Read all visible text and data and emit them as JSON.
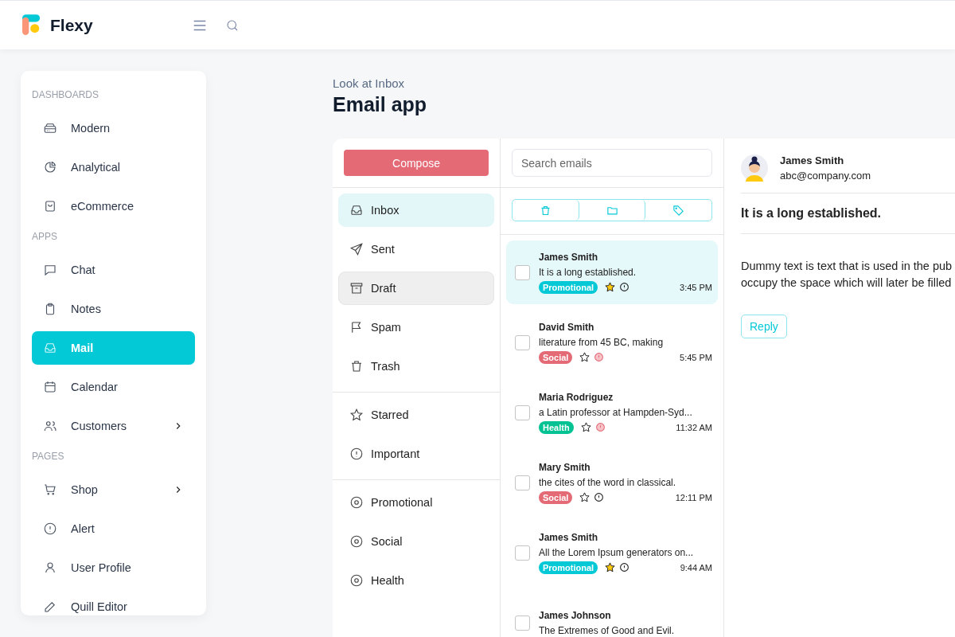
{
  "brand": "Flexy",
  "sidebar": {
    "sections": [
      {
        "title": "DASHBOARDS",
        "items": [
          {
            "label": "Modern",
            "selected": false,
            "submenu": false
          },
          {
            "label": "Analytical",
            "selected": false,
            "submenu": false
          },
          {
            "label": "eCommerce",
            "selected": false,
            "submenu": false
          }
        ]
      },
      {
        "title": "APPS",
        "items": [
          {
            "label": "Chat",
            "selected": false,
            "submenu": false
          },
          {
            "label": "Notes",
            "selected": false,
            "submenu": false
          },
          {
            "label": "Mail",
            "selected": true,
            "submenu": false
          },
          {
            "label": "Calendar",
            "selected": false,
            "submenu": false
          },
          {
            "label": "Customers",
            "selected": false,
            "submenu": true
          }
        ]
      },
      {
        "title": "PAGES",
        "items": [
          {
            "label": "Shop",
            "selected": false,
            "submenu": true
          },
          {
            "label": "Alert",
            "selected": false,
            "submenu": false
          },
          {
            "label": "User Profile",
            "selected": false,
            "submenu": false
          },
          {
            "label": "Quill Editor",
            "selected": false,
            "submenu": false
          }
        ]
      }
    ]
  },
  "page": {
    "subtitle": "Look at Inbox",
    "title": "Email app"
  },
  "folders": {
    "compose": "Compose",
    "groups": [
      [
        {
          "label": "Inbox",
          "selected": true,
          "hovered": false
        },
        {
          "label": "Sent",
          "selected": false,
          "hovered": false
        },
        {
          "label": "Draft",
          "selected": false,
          "hovered": true
        },
        {
          "label": "Spam",
          "selected": false,
          "hovered": false
        },
        {
          "label": "Trash",
          "selected": false,
          "hovered": false
        }
      ],
      [
        {
          "label": "Starred",
          "selected": false,
          "hovered": false
        },
        {
          "label": "Important",
          "selected": false,
          "hovered": false
        }
      ],
      [
        {
          "label": "Promotional",
          "selected": false,
          "hovered": false
        },
        {
          "label": "Social",
          "selected": false,
          "hovered": false
        },
        {
          "label": "Health",
          "selected": false,
          "hovered": false
        }
      ]
    ]
  },
  "mail_list": {
    "search": {
      "placeholder": "Search emails"
    },
    "emails": [
      {
        "sender": "James Smith",
        "excerpt": "It is a long established.",
        "tag": {
          "label": "Promotional",
          "color": "#03c9d7"
        },
        "starred": true,
        "important": false,
        "time": "3:45 PM",
        "selected": true,
        "checked": false
      },
      {
        "sender": "David Smith",
        "excerpt": "literature from 45 BC, making",
        "tag": {
          "label": "Social",
          "color": "#e46a76"
        },
        "starred": false,
        "important": true,
        "time": "5:45 PM",
        "selected": false,
        "checked": false
      },
      {
        "sender": "Maria Rodriguez",
        "excerpt": "a Latin professor at Hampden-Syd...",
        "tag": {
          "label": "Health",
          "color": "#00c292"
        },
        "starred": false,
        "important": true,
        "time": "11:32 AM",
        "selected": false,
        "checked": false
      },
      {
        "sender": "Mary Smith",
        "excerpt": "the cites of the word in classical.",
        "tag": {
          "label": "Social",
          "color": "#e46a76"
        },
        "starred": false,
        "important": false,
        "time": "12:11 PM",
        "selected": false,
        "checked": false
      },
      {
        "sender": "James Smith",
        "excerpt": "All the Lorem Ipsum generators on...",
        "tag": {
          "label": "Promotional",
          "color": "#03c9d7"
        },
        "starred": true,
        "important": false,
        "time": "9:44 AM",
        "selected": false,
        "checked": false
      },
      {
        "sender": "James Johnson",
        "excerpt": "The Extremes of Good and Evil.",
        "selected": false,
        "checked": false
      }
    ]
  },
  "detail": {
    "name": "James Smith",
    "email": "abc@company.com",
    "subject": "It is a long established.",
    "body": [
      "Dummy text is text that is used in the pub",
      "occupy the space which will later be filled"
    ],
    "reply": "Reply"
  }
}
